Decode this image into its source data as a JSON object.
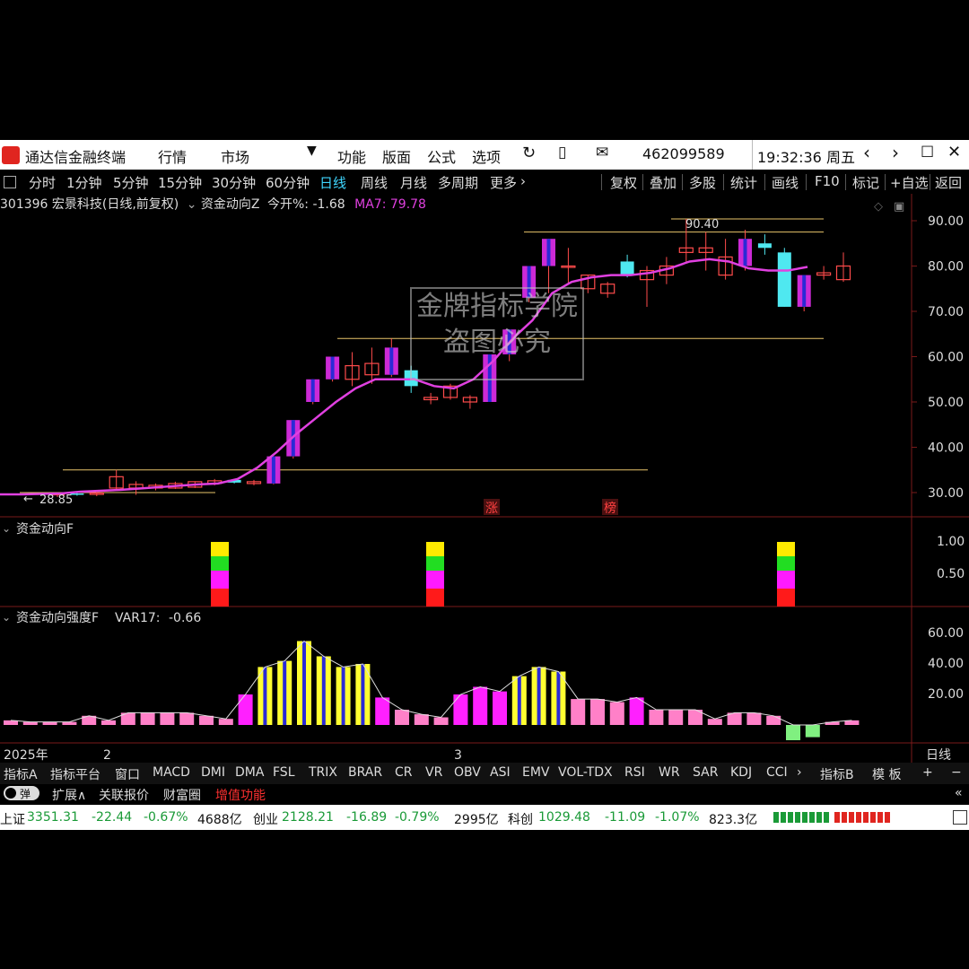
{
  "titlebar": {
    "app_name": "通达信金融终端",
    "menus": [
      "行情",
      "市场",
      "功能",
      "版面",
      "公式",
      "选项"
    ],
    "account": "462099589",
    "clock": "19:32:36 周五",
    "brand_color": "#e0251f"
  },
  "periods": {
    "items": [
      "分时",
      "1分钟",
      "5分钟",
      "15分钟",
      "30分钟",
      "60分钟",
      "日线",
      "周线",
      "月线",
      "多周期",
      "更多"
    ],
    "active": "日线",
    "tools": [
      "复权",
      "叠加",
      "多股",
      "统计",
      "画线",
      "F10",
      "标记",
      "+自选",
      "返回"
    ]
  },
  "main_chart": {
    "stock": "301396 宏景科技(日线,前复权)",
    "indicator": "资金动向Z",
    "open_pct_label": "今开%:",
    "open_pct_value": "-1.68",
    "ma_label": "MA7:",
    "ma_value": "79.78",
    "y_ticks": [
      "90.00",
      "80.00",
      "70.00",
      "60.00",
      "50.00",
      "40.00",
      "30.00"
    ],
    "high_label": "90.40",
    "low_label": "28.85",
    "marks": [
      "涨",
      "榜"
    ]
  },
  "chart_data": {
    "type": "candlestick",
    "ylim": [
      26,
      94
    ],
    "candles": [
      {
        "o": 29.5,
        "h": 30.0,
        "l": 29.0,
        "c": 29.8
      },
      {
        "o": 29.8,
        "h": 30.2,
        "l": 29.3,
        "c": 29.6
      },
      {
        "o": 29.6,
        "h": 30.1,
        "l": 29.2,
        "c": 29.9
      },
      {
        "o": 31.0,
        "h": 35.0,
        "l": 30.5,
        "c": 33.5
      },
      {
        "o": 31.0,
        "h": 32.5,
        "l": 29.5,
        "c": 31.8
      },
      {
        "o": 31.0,
        "h": 32.0,
        "l": 30.5,
        "c": 31.6
      },
      {
        "o": 31.0,
        "h": 32.4,
        "l": 30.8,
        "c": 32.0
      },
      {
        "o": 31.2,
        "h": 32.5,
        "l": 31.0,
        "c": 32.4
      },
      {
        "o": 32.0,
        "h": 33.0,
        "l": 31.6,
        "c": 32.6
      },
      {
        "o": 32.8,
        "h": 33.0,
        "l": 32.0,
        "c": 32.2
      },
      {
        "o": 32.0,
        "h": 32.8,
        "l": 31.6,
        "c": 32.4
      },
      {
        "o": 32.0,
        "h": 38.0,
        "l": 31.8,
        "c": 38.0
      },
      {
        "o": 38.0,
        "h": 46.0,
        "l": 37.5,
        "c": 46.0
      },
      {
        "o": 50.0,
        "h": 55.0,
        "l": 49.5,
        "c": 55.0
      },
      {
        "o": 55.0,
        "h": 60.0,
        "l": 54.5,
        "c": 60.0
      },
      {
        "o": 55.0,
        "h": 61.0,
        "l": 53.5,
        "c": 58.0
      },
      {
        "o": 56.0,
        "h": 62.0,
        "l": 54.0,
        "c": 58.5
      },
      {
        "o": 56.0,
        "h": 64.0,
        "l": 55.5,
        "c": 62.0
      },
      {
        "o": 57.0,
        "h": 58.0,
        "l": 52.0,
        "c": 53.5
      },
      {
        "o": 50.5,
        "h": 52.0,
        "l": 49.5,
        "c": 51.0
      },
      {
        "o": 51.0,
        "h": 54.0,
        "l": 50.5,
        "c": 53.5
      },
      {
        "o": 50.0,
        "h": 51.5,
        "l": 48.5,
        "c": 51.0
      },
      {
        "o": 50.0,
        "h": 60.5,
        "l": 50.0,
        "c": 60.5
      },
      {
        "o": 60.5,
        "h": 66.0,
        "l": 59.0,
        "c": 66.0
      },
      {
        "o": 73.0,
        "h": 80.0,
        "l": 72.0,
        "c": 80.0
      },
      {
        "o": 80.0,
        "h": 86.0,
        "l": 74.0,
        "c": 86.0
      },
      {
        "o": 80.0,
        "h": 84.0,
        "l": 76.0,
        "c": 80.0
      },
      {
        "o": 75.0,
        "h": 78.0,
        "l": 74.0,
        "c": 78.0
      },
      {
        "o": 74.0,
        "h": 76.5,
        "l": 73.0,
        "c": 76.0
      },
      {
        "o": 81.0,
        "h": 82.5,
        "l": 77.5,
        "c": 78.0
      },
      {
        "o": 77.0,
        "h": 80.0,
        "l": 71.0,
        "c": 79.0
      },
      {
        "o": 78.0,
        "h": 82.0,
        "l": 76.0,
        "c": 80.0
      },
      {
        "o": 83.0,
        "h": 90.4,
        "l": 81.0,
        "c": 84.0
      },
      {
        "o": 83.0,
        "h": 87.5,
        "l": 79.0,
        "c": 84.0
      },
      {
        "o": 78.0,
        "h": 86.0,
        "l": 77.0,
        "c": 82.0
      },
      {
        "o": 80.0,
        "h": 88.0,
        "l": 79.0,
        "c": 86.0
      },
      {
        "o": 85.0,
        "h": 87.0,
        "l": 82.5,
        "c": 84.0
      },
      {
        "o": 83.0,
        "h": 84.0,
        "l": 71.0,
        "c": 71.0
      },
      {
        "o": 71.0,
        "h": 78.0,
        "l": 70.0,
        "c": 78.0
      },
      {
        "o": 78.0,
        "h": 80.0,
        "l": 77.0,
        "c": 78.5
      },
      {
        "o": 77.0,
        "h": 83.0,
        "l": 76.5,
        "c": 80.0
      }
    ],
    "ma7": [
      29.6,
      29.7,
      29.8,
      30.2,
      30.4,
      30.6,
      30.9,
      31.2,
      31.5,
      31.8,
      32.0,
      33.0,
      35.5,
      39.0,
      43.0,
      46.5,
      50.0,
      53.0,
      55.0,
      55.0,
      55.0,
      53.5,
      53.0,
      55.0,
      59.0,
      64.0,
      68.0,
      74.0,
      76.5,
      77.5,
      78.0,
      78.0,
      78.5,
      79.5,
      81.0,
      81.5,
      81.0,
      79.5,
      79.0,
      79.0,
      79.8
    ],
    "levels": [
      90.4,
      87.5,
      64.0,
      35.0,
      30.0
    ]
  },
  "panel_f": {
    "label": "资金动向F",
    "y_ticks": [
      "1.00",
      "0.50"
    ]
  },
  "panel_strength": {
    "label": "资金动向强度F",
    "var_label": "VAR17:",
    "var_value": "-0.66",
    "y_ticks": [
      "60.00",
      "40.00",
      "20.00"
    ],
    "values": [
      3,
      2,
      2,
      2,
      6,
      3,
      8,
      8,
      8,
      8,
      6,
      4,
      20,
      38,
      42,
      55,
      45,
      38,
      40,
      18,
      10,
      7,
      5,
      20,
      25,
      22,
      32,
      38,
      35,
      17,
      17,
      15,
      18,
      10,
      10,
      10,
      4,
      8,
      8,
      6,
      -10,
      -8,
      2,
      3
    ]
  },
  "axis": {
    "year": "2025年",
    "months": [
      "2",
      "3"
    ],
    "period_label": "日线"
  },
  "indicators": {
    "items": [
      "指标A",
      "指标平台",
      "窗口",
      "MACD",
      "DMI",
      "DMA",
      "FSL",
      "TRIX",
      "BRAR",
      "CR",
      "VR",
      "OBV",
      "ASI",
      "EMV",
      "VOL-TDX",
      "RSI",
      "WR",
      "SAR",
      "KDJ",
      "CCI"
    ],
    "right": [
      "指标B",
      "模 板"
    ]
  },
  "extbar": {
    "toggle": "弹",
    "items": [
      "扩展∧",
      "关联报价",
      "财富圈"
    ],
    "highlight": "增值功能"
  },
  "statusbar": {
    "indices": [
      {
        "name": "上证",
        "value": "3351.31",
        "change": "-22.44",
        "pct": "-0.67%",
        "volume": "4688亿"
      },
      {
        "name": "创业",
        "value": "2128.21",
        "change": "-16.89",
        "pct": "-0.79%",
        "volume": "2995亿"
      },
      {
        "name": "科创",
        "value": "1029.48",
        "change": "-11.09",
        "pct": "-1.07%",
        "volume": "823.3亿"
      }
    ]
  },
  "watermark": {
    "line1": "金牌指标学院",
    "line2": "盗图必究"
  }
}
